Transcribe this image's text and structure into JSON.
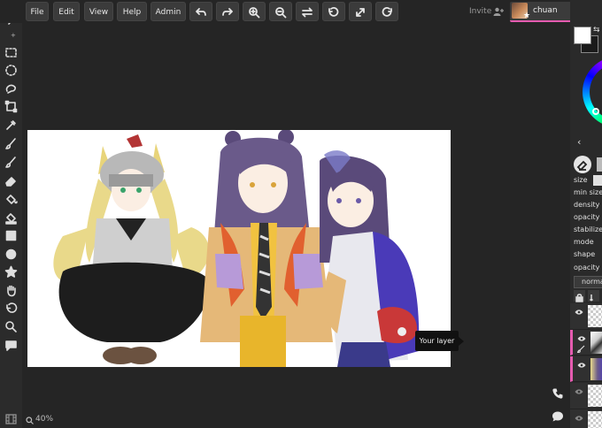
{
  "topbar": {
    "menus": [
      "File",
      "Edit",
      "View",
      "Help",
      "Admin"
    ],
    "tools": [
      "undo-icon",
      "redo-icon",
      "zoom-in-icon",
      "zoom-out-icon",
      "flip-icon",
      "rotate-left-icon",
      "fullscreen-icon",
      "rotate-right-icon"
    ],
    "invite_label": "Invite",
    "user_name": "chuan"
  },
  "left_tools": [
    "menu-chevron-icon",
    "marquee-rect-icon",
    "marquee-ellipse-icon",
    "lasso-icon",
    "transform-icon",
    "eyedropper-icon",
    "brush-icon",
    "eraser-icon",
    "bucket-icon",
    "gradient-icon",
    "rectangle-icon",
    "ellipse-icon",
    "star-icon",
    "hand-icon",
    "rotate-icon",
    "zoom-icon",
    "comment-icon"
  ],
  "canvas": {
    "tooltip": "Your layer",
    "zoom_label": "40%"
  },
  "right_panel": {
    "colors": {
      "primary": "#ffffff",
      "secondary": "#1a1a1a",
      "accent": "#e55bb0"
    },
    "properties": [
      "size",
      "min size",
      "density",
      "opacity",
      "stabilizer",
      "mode",
      "shape",
      "opacity"
    ],
    "blend_mode": "norma"
  }
}
